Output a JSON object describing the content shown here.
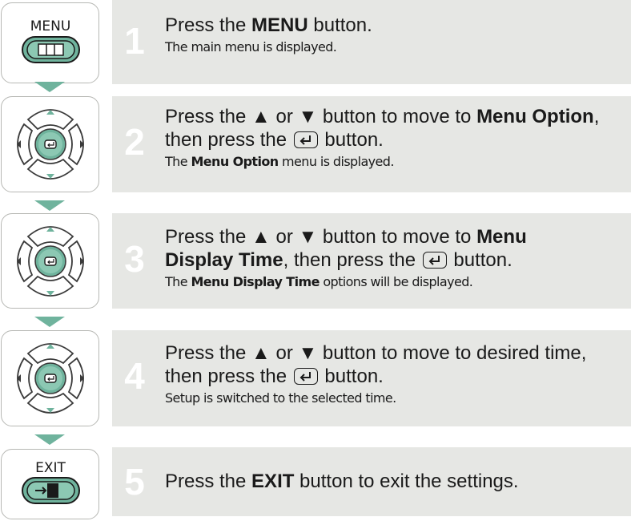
{
  "colors": {
    "accent": "#6fb39d",
    "panel": "#e6e7e4",
    "border": "#b7b8b4",
    "number": "#ffffff"
  },
  "steps": [
    {
      "number": "1",
      "icon": "menu-button-icon",
      "icon_label": "MENU",
      "line1": [
        "Press the ",
        "MENU",
        " button."
      ],
      "sub": "The main menu is displayed."
    },
    {
      "number": "2",
      "icon": "dpad-icon",
      "line1": [
        "Press the ",
        "▲",
        " or ",
        "▼",
        " button to move to ",
        "Menu Option",
        ","
      ],
      "line2": [
        "then press the ",
        "",
        " button."
      ],
      "sub": [
        "The ",
        "Menu Option",
        " menu is displayed."
      ]
    },
    {
      "number": "3",
      "icon": "dpad-icon",
      "line1": [
        "Press the ",
        "▲",
        " or ",
        "▼",
        " button to move to ",
        "Menu"
      ],
      "line2": [
        "Display Time",
        ", then press the ",
        "",
        " button."
      ],
      "sub": [
        "The ",
        "Menu Display Time",
        " options will be displayed."
      ]
    },
    {
      "number": "4",
      "icon": "dpad-icon",
      "line1": [
        "Press the ",
        "▲",
        " or ",
        "▼",
        " button to move to desired time,"
      ],
      "line2": [
        "then press the ",
        "",
        " button."
      ],
      "sub": "Setup is switched to the selected time."
    },
    {
      "number": "5",
      "icon": "exit-button-icon",
      "icon_label": "EXIT",
      "line1": [
        "Press the ",
        "EXIT",
        " button to exit the settings."
      ]
    }
  ]
}
